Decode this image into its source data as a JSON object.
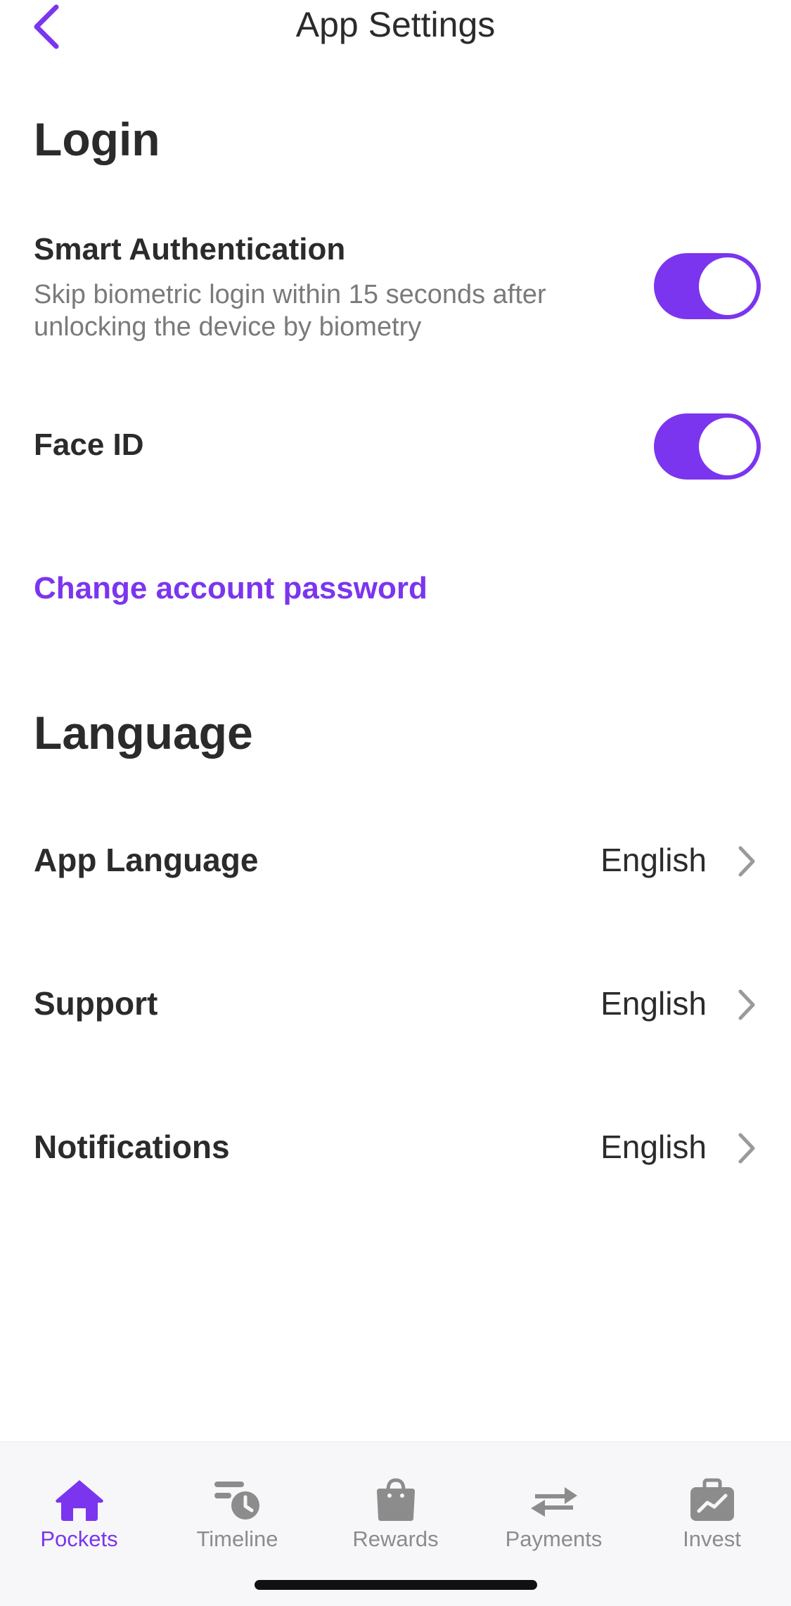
{
  "header": {
    "title": "App Settings",
    "back_icon": "chevron-left-icon"
  },
  "colors": {
    "accent": "#7b35ee",
    "text": "#2b2b2b",
    "muted": "#7a7a7a",
    "tab_inactive": "#8c8c8c"
  },
  "login": {
    "heading": "Login",
    "smart_auth": {
      "title": "Smart Authentication",
      "description": "Skip biometric login within 15 seconds after unlocking the device by biometry",
      "enabled": true
    },
    "face_id": {
      "title": "Face ID",
      "enabled": true
    },
    "change_password_link": "Change account password"
  },
  "language": {
    "heading": "Language",
    "rows": [
      {
        "label": "App Language",
        "value": "English"
      },
      {
        "label": "Support",
        "value": "English"
      },
      {
        "label": "Notifications",
        "value": "English"
      }
    ]
  },
  "tabbar": {
    "tabs": [
      {
        "label": "Pockets",
        "icon": "home-icon",
        "active": true
      },
      {
        "label": "Timeline",
        "icon": "timeline-clock-icon",
        "active": false
      },
      {
        "label": "Rewards",
        "icon": "shopping-bag-icon",
        "active": false
      },
      {
        "label": "Payments",
        "icon": "transfer-arrows-icon",
        "active": false
      },
      {
        "label": "Invest",
        "icon": "briefcase-chart-icon",
        "active": false
      }
    ]
  }
}
